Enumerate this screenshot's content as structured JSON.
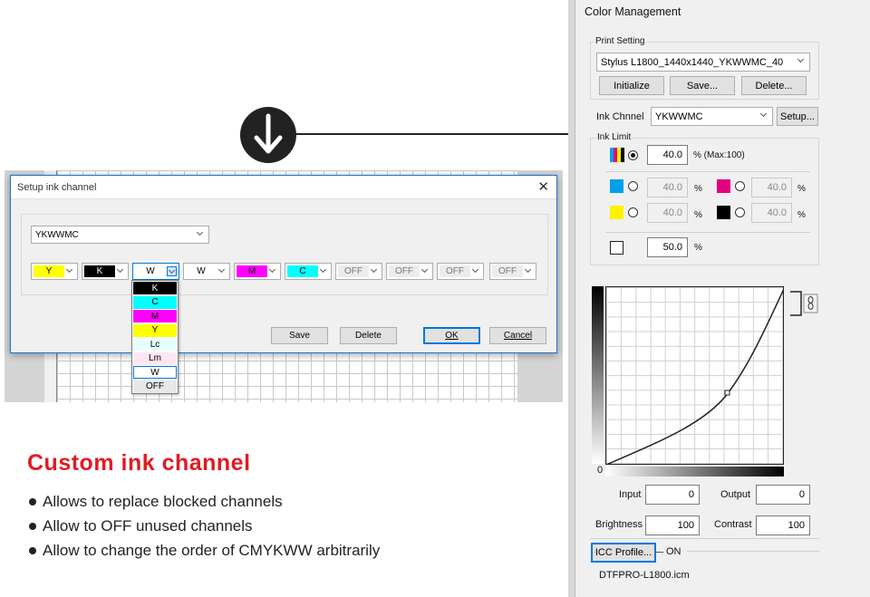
{
  "dialog": {
    "title": "Setup ink channel",
    "close_glyph": "✕",
    "profile_value": "YKWWMC",
    "channels": [
      {
        "label": "Y",
        "bg": "#ffff00",
        "fg": "#000000"
      },
      {
        "label": "K",
        "bg": "#000000",
        "fg": "#ffffff"
      },
      {
        "label": "W",
        "bg": "#ffffff",
        "fg": "#000000"
      },
      {
        "label": "W",
        "bg": "#ffffff",
        "fg": "#000000"
      },
      {
        "label": "M",
        "bg": "#ff00ff",
        "fg": "#000000"
      },
      {
        "label": "C",
        "bg": "#00ffff",
        "fg": "#000000"
      },
      {
        "label": "OFF",
        "bg": "#ececec",
        "fg": "#777777"
      },
      {
        "label": "OFF",
        "bg": "#ececec",
        "fg": "#777777"
      },
      {
        "label": "OFF",
        "bg": "#ececec",
        "fg": "#777777"
      },
      {
        "label": "OFF",
        "bg": "#ececec",
        "fg": "#777777"
      }
    ],
    "dropdown_options": [
      {
        "label": "K",
        "bg": "#000000",
        "fg": "#ffffff"
      },
      {
        "label": "C",
        "bg": "#00ffff",
        "fg": "#000000"
      },
      {
        "label": "M",
        "bg": "#ff00ff",
        "fg": "#000000"
      },
      {
        "label": "Y",
        "bg": "#ffff00",
        "fg": "#000000"
      },
      {
        "label": "Lc",
        "bg": "#e6ffff",
        "fg": "#000000"
      },
      {
        "label": "Lm",
        "bg": "#ffe6f5",
        "fg": "#000000"
      },
      {
        "label": "W",
        "bg": "#ffffff",
        "fg": "#000000"
      },
      {
        "label": "OFF",
        "bg": "#e8e8e8",
        "fg": "#000000"
      }
    ],
    "save_label": "Save",
    "delete_label": "Delete",
    "ok_label": "OK",
    "cancel_label": "Cancel"
  },
  "headline": "Custom ink channel",
  "bullets": [
    "Allows to replace blocked channels",
    "Allow to OFF unused channels",
    "Allow to change the order of CMYKWW arbitrarily"
  ],
  "panel": {
    "title": "Color Management",
    "print_setting": {
      "label": "Print Setting",
      "value": "Stylus L1800_1440x1440_YKWWMC_40",
      "initialize_label": "Initialize",
      "save_label": "Save...",
      "delete_label": "Delete..."
    },
    "ink_channel": {
      "label": "Ink Chnnel",
      "value": "YKWWMC",
      "setup_label": "Setup..."
    },
    "ink_limit": {
      "label": "Ink Limit",
      "total_value": "40.0",
      "total_unit": "% (Max:100)",
      "c_value": "40.0",
      "m_value": "40.0",
      "y_value": "40.0",
      "k_value": "40.0",
      "percent": "%",
      "white_value": "50.0"
    },
    "curve": {
      "zero_label": "0",
      "input_label": "Input",
      "input_value": "0",
      "output_label": "Output",
      "output_value": "0",
      "brightness_label": "Brightness",
      "brightness_value": "100",
      "contrast_label": "Contrast",
      "contrast_value": "100"
    },
    "icc": {
      "button_label": "ICC Profile...",
      "state": "ON",
      "filename": "DTFPRO-L1800.icm"
    }
  },
  "colors": {
    "headline": "#e01b24",
    "cyan": "#00a0e9",
    "magenta": "#e4007f",
    "yellow": "#fff100",
    "black": "#000000",
    "accent": "#0078d7"
  }
}
